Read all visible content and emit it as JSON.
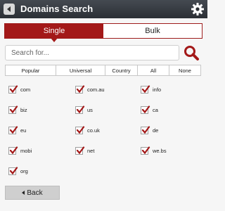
{
  "header": {
    "title": "Domains Search",
    "back_icon": "back-arrow-icon",
    "settings_icon": "gear-icon"
  },
  "tabs": [
    {
      "label": "Single",
      "active": true
    },
    {
      "label": "Bulk",
      "active": false
    }
  ],
  "search": {
    "placeholder": "Search for...",
    "value": ""
  },
  "filters": [
    "Popular",
    "Universal",
    "Country",
    "All",
    "None"
  ],
  "domains": [
    {
      "label": "com",
      "checked": true
    },
    {
      "label": "com.au",
      "checked": true
    },
    {
      "label": "info",
      "checked": true
    },
    {
      "label": "biz",
      "checked": true
    },
    {
      "label": "us",
      "checked": true
    },
    {
      "label": "ca",
      "checked": true
    },
    {
      "label": "eu",
      "checked": true
    },
    {
      "label": "co.uk",
      "checked": true
    },
    {
      "label": "de",
      "checked": true
    },
    {
      "label": "mobi",
      "checked": true
    },
    {
      "label": "net",
      "checked": true
    },
    {
      "label": "we.bs",
      "checked": true
    },
    {
      "label": "org",
      "checked": true
    }
  ],
  "footer": {
    "back_label": "Back"
  },
  "colors": {
    "accent": "#a31818",
    "header_bg": "#2c3035",
    "page_bg": "#f6f6f6"
  }
}
